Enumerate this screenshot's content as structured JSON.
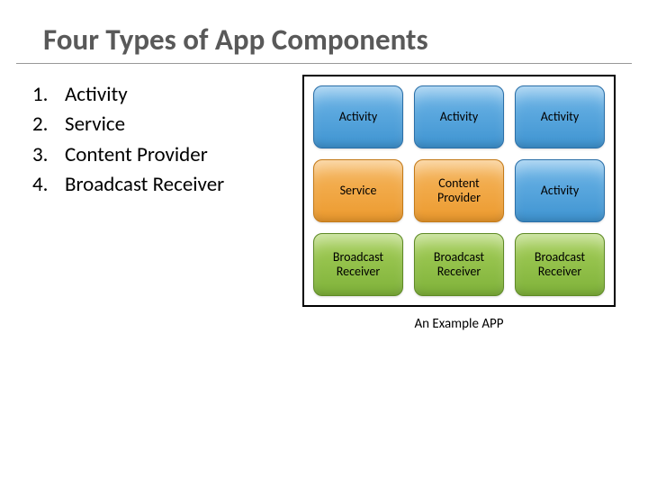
{
  "title": "Four Types of App Components",
  "list": {
    "items": [
      "Activity",
      "Service",
      "Content Provider",
      "Broadcast Receiver"
    ]
  },
  "grid": {
    "cells": [
      {
        "label": "Activity",
        "color": "blue"
      },
      {
        "label": "Activity",
        "color": "blue"
      },
      {
        "label": "Activity",
        "color": "blue"
      },
      {
        "label": "Service",
        "color": "orange"
      },
      {
        "label": "Content Provider",
        "color": "orange"
      },
      {
        "label": "Activity",
        "color": "blue"
      },
      {
        "label": "Broadcast Receiver",
        "color": "green"
      },
      {
        "label": "Broadcast Receiver",
        "color": "green"
      },
      {
        "label": "Broadcast Receiver",
        "color": "green"
      }
    ]
  },
  "caption": "An Example APP"
}
